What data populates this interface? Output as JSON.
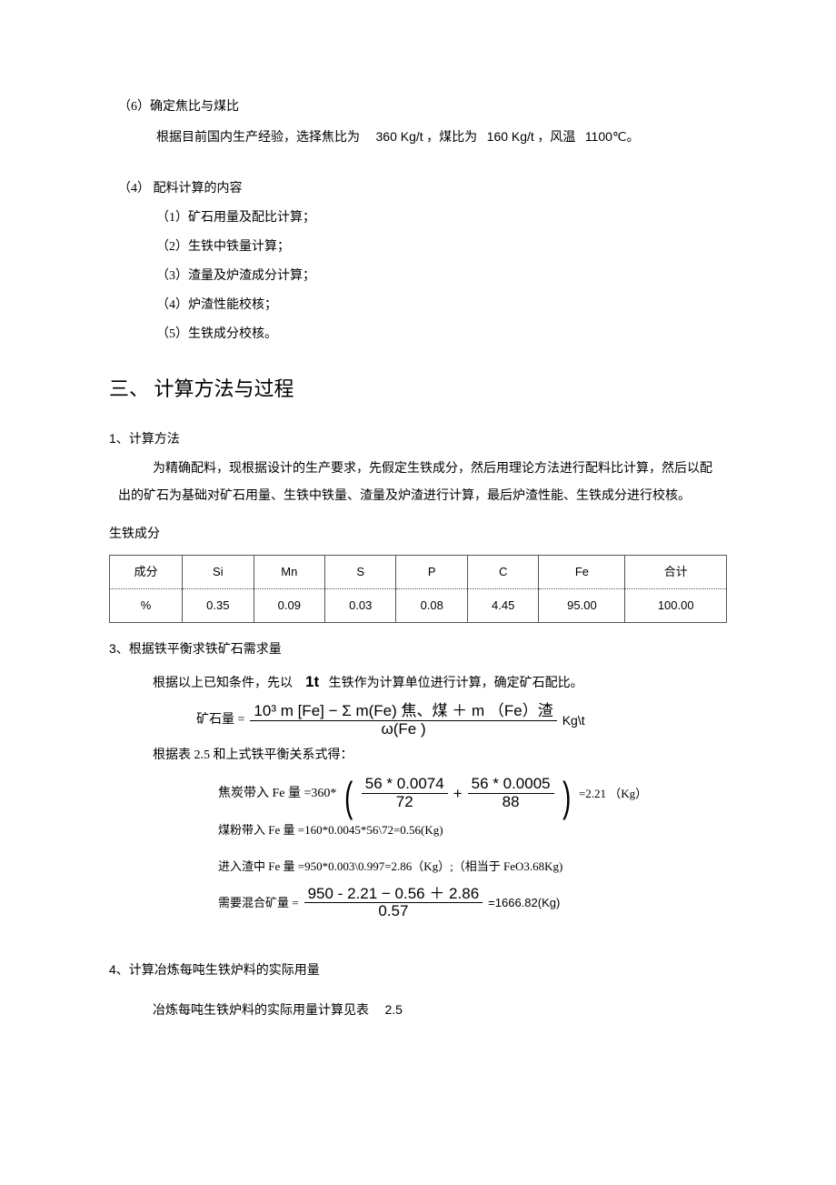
{
  "sec6": {
    "title": "（6）确定焦比与煤比",
    "body_prefix": "根据目前国内生产经验，选择焦比为",
    "coke_ratio": "360 Kg/t",
    "mid1": "，煤比为",
    "coal_ratio": "160 Kg/t",
    "mid2": "，风温",
    "wind_temp": "1100℃。"
  },
  "sec4title": "（4）  配料计算的内容",
  "sec4items": {
    "i1": "（1）矿石用量及配比计算；",
    "i2": "（2）生铁中铁量计算；",
    "i3": "（3）渣量及炉渣成分计算；",
    "i4": "（4）炉渣性能校核；",
    "i5": "（5）生铁成分校核。"
  },
  "h2": "三、 计算方法与过程",
  "m1": {
    "title": "1、计算方法",
    "p1": "为精确配料，现根据设计的生产要求，先假定生铁成分，然后用理论方法进行配料比计算，然后以配",
    "p2": "出的矿石为基础对矿石用量、生铁中铁量、渣量及炉渣进行计算，最后炉渣性能、生铁成分进行校核。"
  },
  "table_caption": "生铁成分",
  "table": {
    "headers": {
      "c0": "成分",
      "c1": "Si",
      "c2": "Mn",
      "c3": "S",
      "c4": "P",
      "c5": "C",
      "c6": "Fe",
      "c7": "合计"
    },
    "row": {
      "c0": "%",
      "c1": "0.35",
      "c2": "0.09",
      "c3": "0.03",
      "c4": "0.08",
      "c5": "4.45",
      "c6": "95.00",
      "c7": "100.00"
    }
  },
  "m3": {
    "title": "3、根据铁平衡求铁矿石需求量",
    "intro_pre": "根据以上已知条件，先以",
    "intro_unit": "1t",
    "intro_post": "生铁作为计算单位进行计算，确定矿石配比。",
    "eq_label": "矿石量 =",
    "eq_num": "10³ m [Fe] − Σ m(Fe) 焦、煤  ＋ m （Fe）渣",
    "eq_den": "ω(Fe )",
    "eq_unit": "Kg\\t",
    "line2": "根据表 2.5 和上式铁平衡关系式得：",
    "coke_label": "焦炭带入  Fe 量 =360*",
    "coke_f1_num": "56 * 0.0074",
    "coke_f1_den": "72",
    "coke_plus": "+",
    "coke_f2_num": "56 * 0.0005",
    "coke_f2_den": "88",
    "coke_result": "=2.21 （Kg）",
    "coal_line": "煤粉带入  Fe 量 =160*0.0045*56\\72=0.56(Kg)",
    "slag_line": "进入渣中  Fe 量 =950*0.003\\0.997=2.86（Kg）;（相当于  FeO3.68Kg)",
    "mix_label": "需要混合矿量 =",
    "mix_num": "950 - 2.21 − 0.56 ＋ 2.86",
    "mix_den": "0.57",
    "mix_result": "=1666.82(Kg)"
  },
  "m4": {
    "title": "4、计算冶炼每吨生铁炉料的实际用量",
    "body_pre": "冶炼每吨生铁炉料的实际用量计算见表",
    "body_ref": "2.5"
  }
}
